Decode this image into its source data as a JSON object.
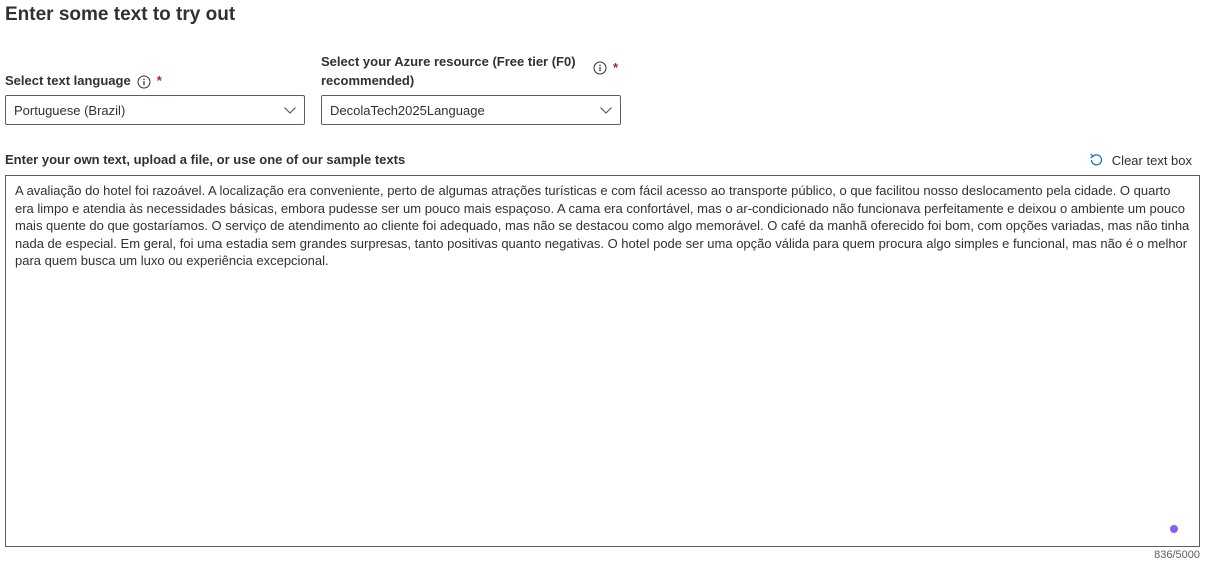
{
  "page": {
    "title": "Enter some text to try out"
  },
  "language": {
    "label": "Select text language",
    "selected": "Portuguese (Brazil)"
  },
  "resource": {
    "label": "Select your Azure resource (Free tier (F0) recommended)",
    "selected": "DecolaTech2025Language"
  },
  "required_marker": "*",
  "text_input": {
    "label": "Enter your own text, upload a file, or use one of our sample texts",
    "clear_label": "Clear text box",
    "value": "A avaliação do hotel foi razoável. A localização era conveniente, perto de algumas atrações turísticas e com fácil acesso ao transporte público, o que facilitou nosso deslocamento pela cidade. O quarto era limpo e atendia às necessidades básicas, embora pudesse ser um pouco mais espaçoso. A cama era confortável, mas o ar-condicionado não funcionava perfeitamente e deixou o ambiente um pouco mais quente do que gostaríamos. O serviço de atendimento ao cliente foi adequado, mas não se destacou como algo memorável. O café da manhã oferecido foi bom, com opções variadas, mas não tinha nada de especial. Em geral, foi uma estadia sem grandes surpresas, tanto positivas quanto negativas. O hotel pode ser uma opção válida para quem procura algo simples e funcional, mas não é o melhor para quem busca um luxo ou experiência excepcional.",
    "char_count": "836/5000"
  },
  "icons": {
    "info": "info-icon",
    "chevron": "chevron-down-icon",
    "clear": "undo-icon"
  },
  "colors": {
    "required": "#a4262c",
    "border": "#605e5c",
    "indicator": "#8a5cf6"
  }
}
